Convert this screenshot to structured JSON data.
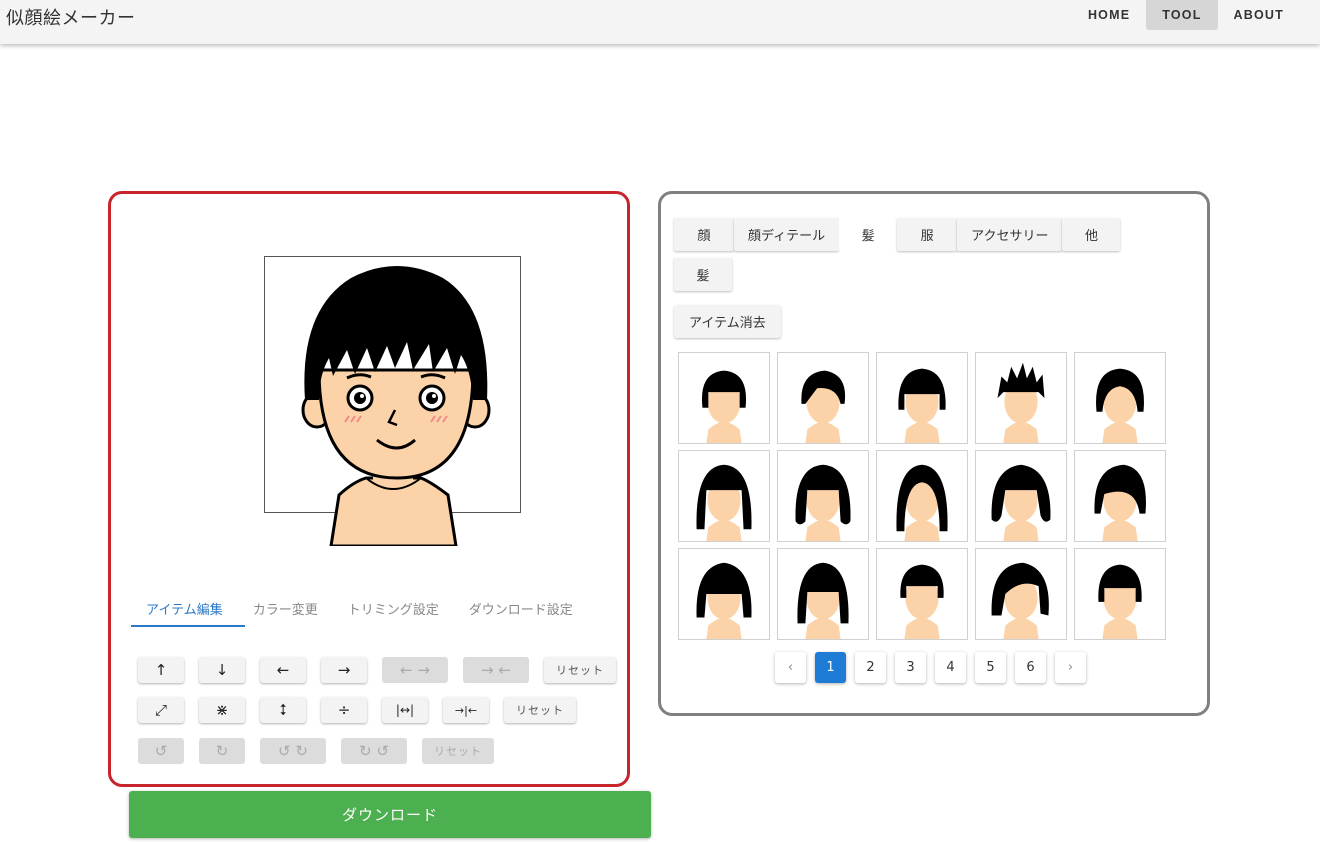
{
  "app": {
    "title": "似顔絵メーカー"
  },
  "nav": [
    {
      "label": "HOME",
      "active": false
    },
    {
      "label": "TOOL",
      "active": true
    },
    {
      "label": "ABOUT",
      "active": false
    }
  ],
  "editor": {
    "tabs": [
      {
        "label": "アイテム編集",
        "active": true
      },
      {
        "label": "カラー変更",
        "active": false
      },
      {
        "label": "トリミング設定",
        "active": false
      },
      {
        "label": "ダウンロード設定",
        "active": false
      }
    ],
    "move_controls": [
      {
        "icon": "arrow-up-icon",
        "glyph": "↑",
        "disabled": false
      },
      {
        "icon": "arrow-down-icon",
        "glyph": "↓",
        "disabled": false
      },
      {
        "icon": "arrow-left-icon",
        "glyph": "←",
        "disabled": false
      },
      {
        "icon": "arrow-right-icon",
        "glyph": "→",
        "disabled": false
      },
      {
        "icon": "spread-horizontal-icon",
        "glyph": "← →",
        "disabled": true
      },
      {
        "icon": "narrow-horizontal-icon",
        "glyph": "→ ←",
        "disabled": true
      }
    ],
    "size_controls": [
      {
        "icon": "expand-icon",
        "glyph": "⤢",
        "disabled": false
      },
      {
        "icon": "shrink-icon",
        "glyph": "⋇",
        "disabled": false
      },
      {
        "icon": "stretch-vertical-icon",
        "glyph": "⭥",
        "disabled": false
      },
      {
        "icon": "compress-vertical-icon",
        "glyph": "÷",
        "disabled": false
      },
      {
        "icon": "stretch-horizontal-icon",
        "glyph": "|↔|",
        "disabled": false
      },
      {
        "icon": "compress-horizontal-icon",
        "glyph": "→|←",
        "disabled": false
      }
    ],
    "rotate_controls": [
      {
        "icon": "rotate-left-icon",
        "glyph": "↺",
        "disabled": true
      },
      {
        "icon": "rotate-right-icon",
        "glyph": "↻",
        "disabled": true
      },
      {
        "icon": "rotate-outward-icon",
        "glyph": "↺ ↻",
        "disabled": true
      },
      {
        "icon": "rotate-inward-icon",
        "glyph": "↻ ↺",
        "disabled": true
      }
    ],
    "reset_label": "リセット",
    "download_label": "ダウンロード"
  },
  "panel": {
    "categories_row1": [
      {
        "label": "顔",
        "active": false
      },
      {
        "label": "顔ディテール",
        "active": false
      },
      {
        "label": "髪",
        "active": true
      },
      {
        "label": "服",
        "active": false
      },
      {
        "label": "アクセサリー",
        "active": false
      },
      {
        "label": "他",
        "active": false
      }
    ],
    "categories_row2": [
      {
        "label": "髪",
        "active": false
      }
    ],
    "clear_label": "アイテム消去",
    "hair_styles": [
      "short-bob",
      "side-part",
      "bowl-cut",
      "spiky",
      "mushroom",
      "long-straight",
      "wavy-bob",
      "long-center",
      "curly-bob",
      "side-swept",
      "hime-cut",
      "round-bob",
      "short-neat",
      "volume-wave",
      "short-crop"
    ],
    "pages": [
      "1",
      "2",
      "3",
      "4",
      "5",
      "6"
    ],
    "current_page": "1",
    "prev_glyph": "‹",
    "next_glyph": "›"
  },
  "colors": {
    "accent_blue": "#1e7bd6",
    "download_green": "#4caf50",
    "editor_border": "#c8242c",
    "panel_border": "#808080",
    "skin": "#fcd3a8"
  }
}
